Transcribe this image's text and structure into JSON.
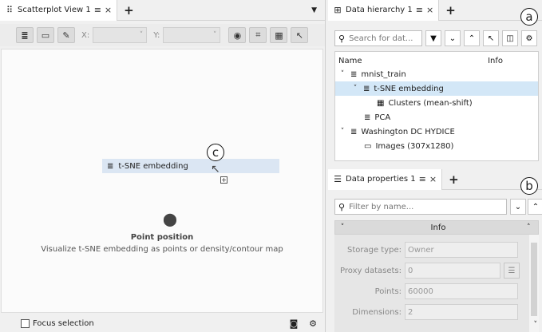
{
  "scatterplot": {
    "tab_title": "Scatterplot View 1",
    "x_label": "X:",
    "y_label": "Y:",
    "drag_item": "t-SNE embedding",
    "callout": "c",
    "point_title": "Point position",
    "point_desc": "Visualize t-SNE embedding as points or density/contour map",
    "focus_selection": "Focus selection"
  },
  "hierarchy": {
    "tab_title": "Data hierarchy 1",
    "search_placeholder": "Search for dat...",
    "callout": "a",
    "col_name": "Name",
    "col_info": "Info",
    "items": [
      {
        "label": "mnist_train",
        "level": 0,
        "chev": "˅"
      },
      {
        "label": "t-SNE embedding",
        "level": 1,
        "chev": "˅"
      },
      {
        "label": "Clusters (mean-shift)",
        "level": 2,
        "chev": ""
      },
      {
        "label": "PCA",
        "level": 1,
        "chev": ""
      },
      {
        "label": "Washington DC HYDICE",
        "level": 0,
        "chev": "˅"
      },
      {
        "label": "Images (307x1280)",
        "level": 1,
        "chev": ""
      }
    ]
  },
  "properties": {
    "tab_title": "Data properties 1",
    "search_placeholder": "Filter by name...",
    "callout": "b",
    "group": "Info",
    "rows": [
      {
        "label": "Storage type:",
        "value": "Owner"
      },
      {
        "label": "Proxy datasets:",
        "value": "0"
      },
      {
        "label": "Points:",
        "value": "60000"
      },
      {
        "label": "Dimensions:",
        "value": "2"
      }
    ]
  },
  "icons": {
    "tab_menu": "≡",
    "tab_close": "×",
    "tab_add": "+"
  }
}
